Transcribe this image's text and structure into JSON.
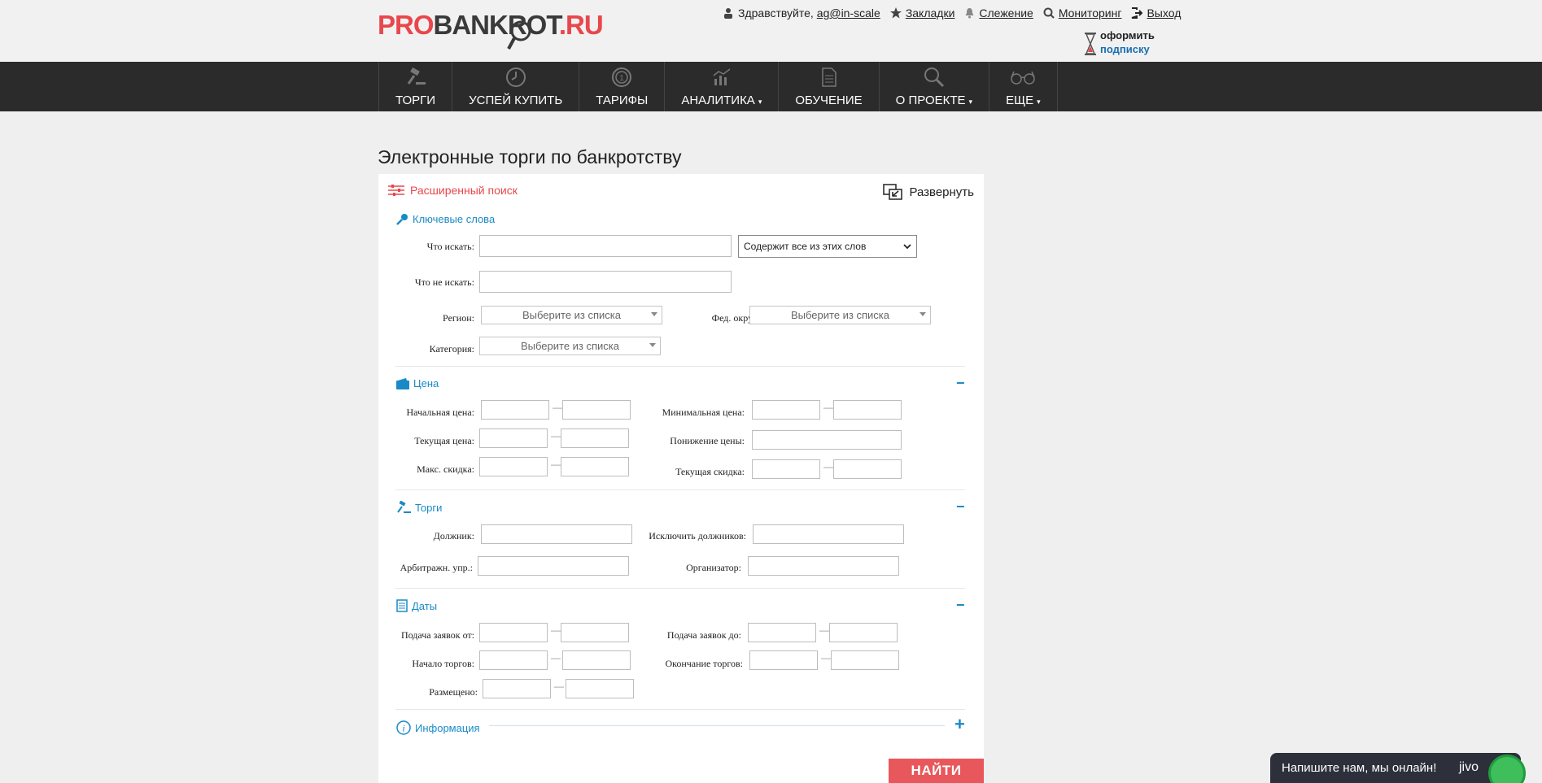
{
  "header": {
    "logo": {
      "pro": "PRO",
      "bank": "BANKROT",
      "ru": ".RU"
    },
    "greeting": "Здравствуйте,",
    "user": "ag@in-scale",
    "links": [
      "Закладки",
      "Слежение",
      "Мониторинг",
      "Выход"
    ],
    "subscription": {
      "line1": "оформить",
      "line2": "подписку"
    }
  },
  "nav": {
    "items": [
      {
        "label": "ТОРГИ",
        "icon": "gavel-icon",
        "caret": ""
      },
      {
        "label": "УСПЕЙ КУПИТЬ",
        "icon": "clock-icon",
        "caret": ""
      },
      {
        "label": "ТАРИФЫ",
        "icon": "coin-icon",
        "caret": ""
      },
      {
        "label": "АНАЛИТИКА",
        "icon": "chart-icon",
        "caret": "▾"
      },
      {
        "label": "ОБУЧЕНИЕ",
        "icon": "document-icon",
        "caret": ""
      },
      {
        "label": "О ПРОЕКТЕ",
        "icon": "search-icon",
        "caret": "▾"
      },
      {
        "label": "ЕЩЕ",
        "icon": "glasses-icon",
        "caret": "▾"
      }
    ]
  },
  "page": {
    "title": "Электронные торги по банкротству"
  },
  "panel": {
    "head": "Расширенный поиск",
    "expand": "Развернуть",
    "keywords": {
      "title": "Ключевые слова",
      "what_label": "Что искать:",
      "what_value": "",
      "mode_selected": "Содержит все из этих слов",
      "not_label": "Что не искать:",
      "not_value": "",
      "region_label": "Регион:",
      "region_placeholder": "Выберите из списка",
      "fed_label": "Фед. округ",
      "fed_placeholder": "Выберите из списка",
      "category_label": "Категория:",
      "category_placeholder": "Выберите из списка"
    },
    "price": {
      "title": "Цена",
      "start_label": "Начальная цена:",
      "current_label": "Текущая цена:",
      "max_discount_label": "Макс. скидка:",
      "min_label": "Минимальная цена:",
      "decrease_label": "Понижение цены:",
      "current_discount_label": "Текущая скидка:"
    },
    "torgi": {
      "title": "Торги",
      "debtor_label": "Должник:",
      "exclude_label": "Исключить должников:",
      "arbitr_label": "Арбитражн. упр.:",
      "organizer_label": "Организатор:"
    },
    "dates": {
      "title": "Даты",
      "apply_from_label": "Подача заявок от:",
      "apply_to_label": "Подача заявок до:",
      "start_label": "Начало торгов:",
      "end_label": "Окончание торгов:",
      "posted_label": "Размещено:"
    },
    "info": {
      "title": "Информация"
    },
    "find_button": "НАЙТИ"
  },
  "jivo": {
    "text": "Напишите нам, мы онлайн!",
    "brand": "jivo"
  },
  "colors": {
    "accent_red": "#e8474c",
    "link_blue": "#1a8ac6",
    "nav_bg": "#2b2b2b"
  }
}
